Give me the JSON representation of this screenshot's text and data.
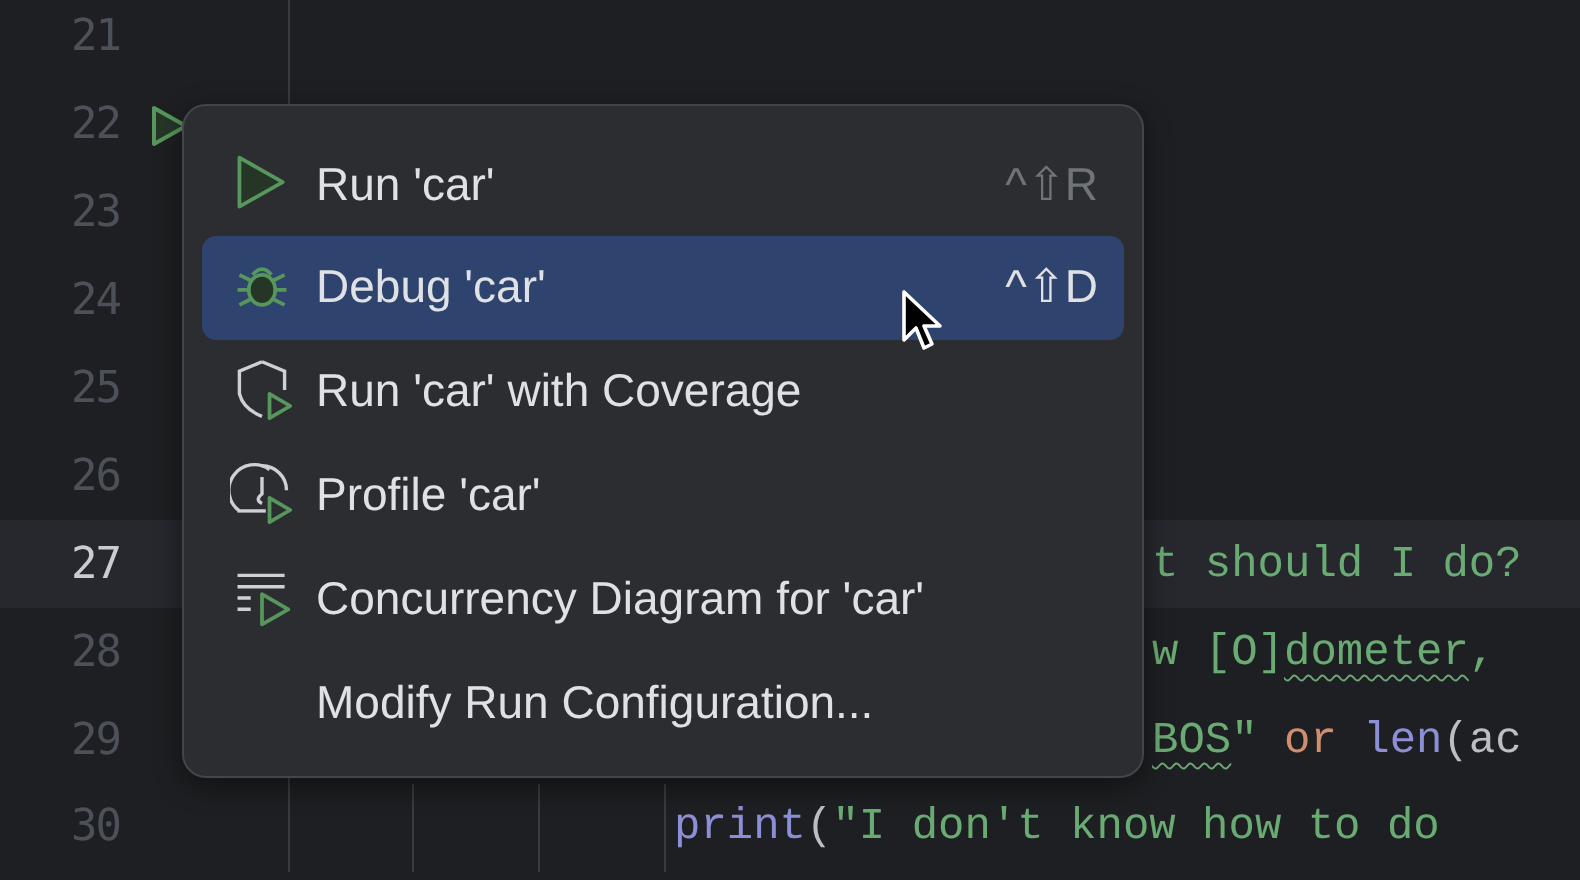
{
  "editor": {
    "lines": [
      {
        "number": "21",
        "current": false,
        "run_marker": false,
        "indent_guides": false
      },
      {
        "number": "22",
        "current": false,
        "run_marker": true,
        "indent_guides": false
      },
      {
        "number": "23",
        "current": false,
        "run_marker": false,
        "indent_guides": false
      },
      {
        "number": "24",
        "current": false,
        "run_marker": false,
        "indent_guides": false
      },
      {
        "number": "25",
        "current": false,
        "run_marker": false,
        "indent_guides": false
      },
      {
        "number": "26",
        "current": false,
        "run_marker": false,
        "indent_guides": false
      },
      {
        "number": "27",
        "current": true,
        "run_marker": false,
        "indent_guides": false,
        "segments": [
          {
            "text": "t should I do?",
            "kind": "string",
            "warning": false
          }
        ]
      },
      {
        "number": "28",
        "current": false,
        "run_marker": false,
        "indent_guides": false,
        "segments": [
          {
            "text": "w [O]",
            "kind": "string",
            "warning": false
          },
          {
            "text": "dometer",
            "kind": "string",
            "warning": true
          },
          {
            "text": ",",
            "kind": "string",
            "warning": false
          }
        ]
      },
      {
        "number": "29",
        "current": false,
        "run_marker": false,
        "indent_guides": false,
        "segments": [
          {
            "text": "BOS",
            "kind": "string",
            "warning": true
          },
          {
            "text": "\"",
            "kind": "string",
            "warning": false
          },
          {
            "text": " or ",
            "kind": "keyword",
            "warning": false
          },
          {
            "text": "len",
            "kind": "function",
            "warning": false
          },
          {
            "text": "(ac",
            "kind": "plain",
            "warning": false
          }
        ]
      },
      {
        "number": "30",
        "current": false,
        "run_marker": false,
        "indent_guides": true,
        "segments": [
          {
            "text": "print",
            "kind": "function",
            "warning": false
          },
          {
            "text": "(",
            "kind": "plain",
            "warning": false
          },
          {
            "text": "\"I don't know how to do",
            "kind": "string",
            "warning": false
          }
        ]
      }
    ]
  },
  "menu": {
    "items": [
      {
        "label": "Run 'car'",
        "shortcut": "^⇧R",
        "kind": "run",
        "selected": false
      },
      {
        "label": "Debug 'car'",
        "shortcut": "^⇧D",
        "kind": "debug",
        "selected": true
      },
      {
        "label": "Run 'car' with Coverage",
        "kind": "coverage",
        "selected": false
      },
      {
        "label": "Profile 'car'",
        "kind": "profile",
        "selected": false
      },
      {
        "label": "Concurrency Diagram for 'car'",
        "kind": "concurrency",
        "selected": false
      },
      {
        "label": "Modify Run Configuration...",
        "kind": "none",
        "selected": false
      }
    ]
  }
}
